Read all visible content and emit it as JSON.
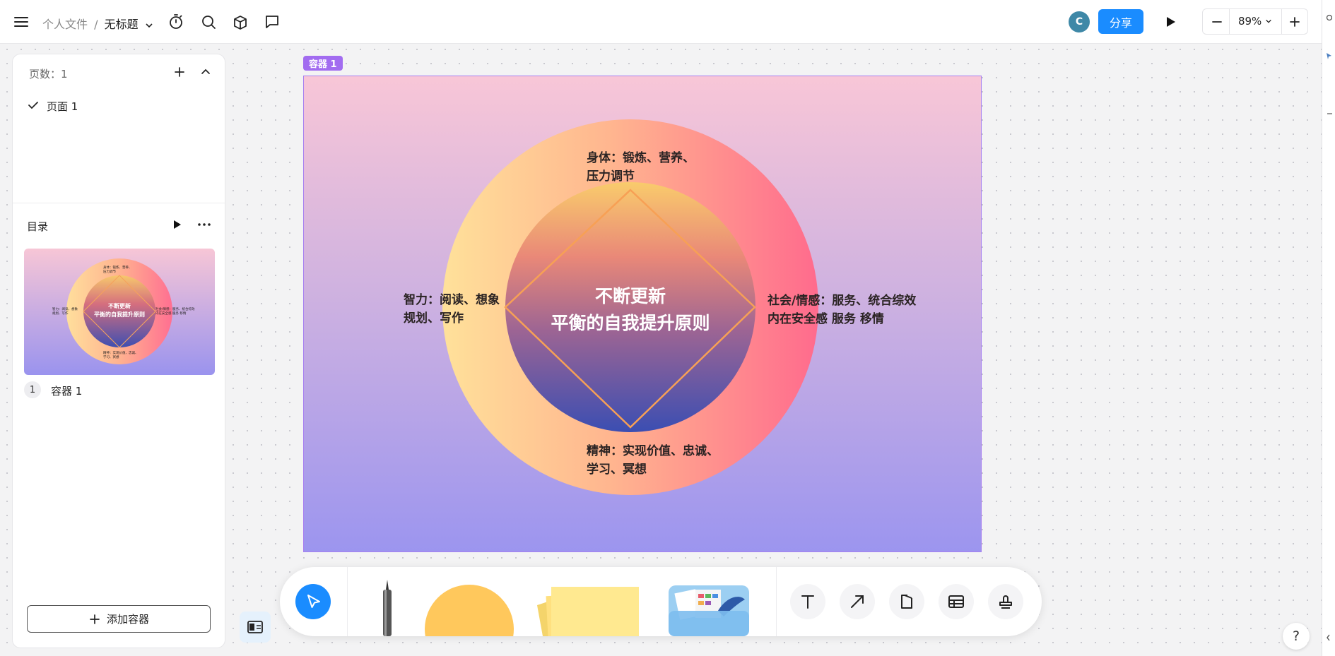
{
  "header": {
    "breadcrumb_parent": "个人文件",
    "breadcrumb_sep": "/",
    "doc_title": "无标题",
    "avatar_letter": "C",
    "share_label": "分享",
    "zoom_level": "89%"
  },
  "sidebar": {
    "page_count_label": "页数：1",
    "pages": [
      {
        "label": "页面 1"
      }
    ],
    "toc_title": "目录",
    "containers": [
      {
        "index": "1",
        "label": "容器 1"
      }
    ],
    "add_container_label": "添加容器"
  },
  "canvas": {
    "frame_label": "容器 1",
    "title_line1": "不断更新",
    "title_line2": "平衡的自我提升原则",
    "top_label_line1": "身体：锻炼、营养、",
    "top_label_line2": "压力调节",
    "left_label_line1": "智力：阅读、想象",
    "left_label_line2": "规划、写作",
    "right_label_line1": "社会/情感：服务、统合综效",
    "right_label_line2": "内在安全感 服务 移情",
    "bottom_label_line1": "精神：实现价值、忠诚、",
    "bottom_label_line2": "学习、冥想"
  },
  "thumbnail": {
    "title_line1": "不断更新",
    "title_line2": "平衡的自我提升原则",
    "top_line1": "身体：锻炼、营养、",
    "top_line2": "压力调节",
    "left_line1": "智力：阅读、想象",
    "left_line2": "规划、写作",
    "right_line1": "社会/情感：服务、统合综效",
    "right_line2": "内在安全感 服务 移情",
    "bottom_line1": "精神：实现价值、忠诚、",
    "bottom_line2": "学习、冥想"
  },
  "colors": {
    "accent": "#1a8cff",
    "frame_border": "#a67ff0",
    "frame_label_bg": "#a26cf0"
  },
  "help_label": "?"
}
